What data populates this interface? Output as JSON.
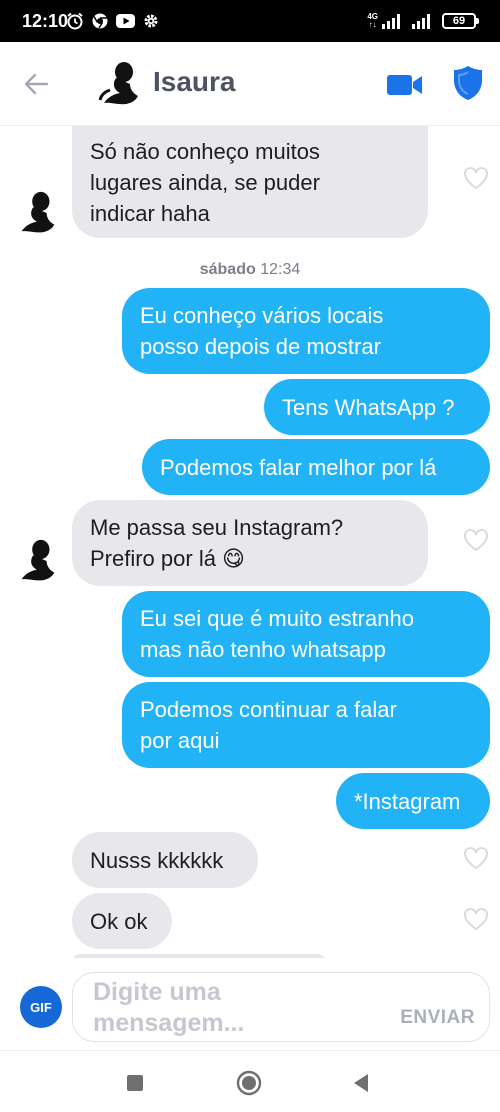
{
  "status_bar": {
    "time": "12:10",
    "network_type": "4G",
    "battery": "69",
    "icons": [
      "alarm-icon",
      "chrome-icon",
      "youtube-icon",
      "settings-icon"
    ]
  },
  "header": {
    "contact_name": "Isaura",
    "icons": [
      "back-arrow-icon",
      "video-call-icon",
      "shield-icon"
    ]
  },
  "colors": {
    "sent_bubble": "#21b3f6",
    "received_bubble": "#e8e8ec",
    "accent_blue": "#1a73e8",
    "gif_button": "#1668d6"
  },
  "messages": [
    {
      "direction": "received",
      "text": "Só não conheço muitos\nlugares ainda, se puder\nindicar haha"
    },
    {
      "direction": "separator",
      "day": "sábado",
      "time": "12:34"
    },
    {
      "direction": "sent",
      "text": "Eu conheço vários locais\nposso depois de mostrar"
    },
    {
      "direction": "sent",
      "text": "Tens WhatsApp ?"
    },
    {
      "direction": "sent",
      "text": "Podemos falar melhor por lá"
    },
    {
      "direction": "received",
      "text": "Me passa seu Instagram?\nPrefiro por lá 😋"
    },
    {
      "direction": "sent",
      "text": "Eu sei que é muito estranho\nmas não tenho whatsapp"
    },
    {
      "direction": "sent",
      "text": "Podemos continuar a falar\npor aqui"
    },
    {
      "direction": "sent",
      "text": "*Instagram"
    },
    {
      "direction": "received",
      "text": "Nusss kkkkkk"
    },
    {
      "direction": "received",
      "text": "Ok ok"
    }
  ],
  "composer": {
    "gif_label": "GIF",
    "placeholder": "Digite uma mensagem...",
    "send_label": "ENVIAR"
  },
  "navigation": {
    "buttons": [
      "recent-apps-icon",
      "home-icon",
      "back-icon"
    ]
  }
}
